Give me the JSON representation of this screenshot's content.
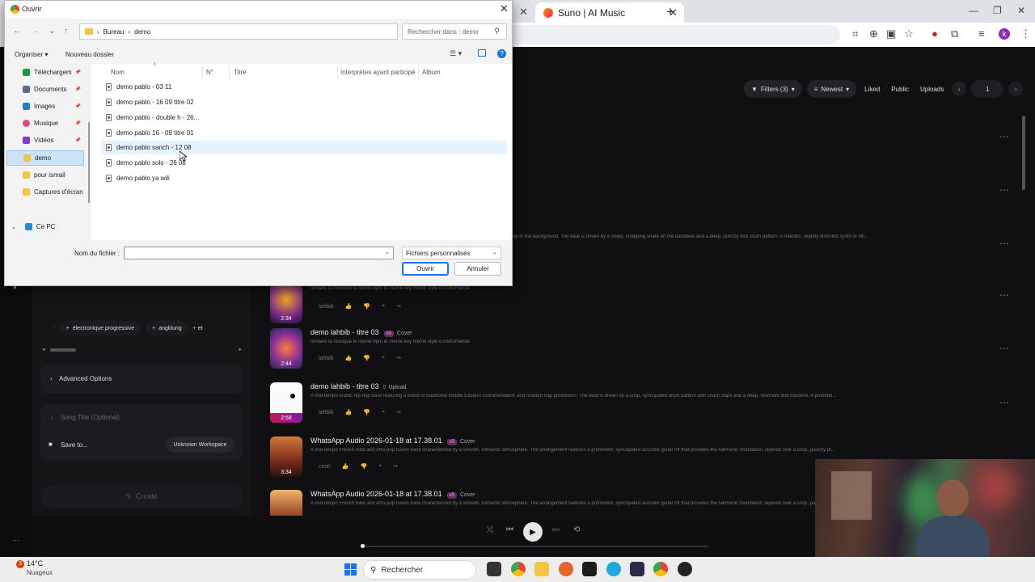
{
  "browser": {
    "active_tab": "Suno | AI Music",
    "toolbar_icons": [
      "translate-icon",
      "zoom-icon",
      "screenshot-icon",
      "bookmark-star-icon",
      "extension-icon",
      "puzzle-icon",
      "media-icon"
    ],
    "profile_initial": "k"
  },
  "dialog": {
    "title": "Ouvrir",
    "address": {
      "root": "Bureau",
      "sep": "›",
      "folder": "demo"
    },
    "search_placeholder": "Rechercher dans : demo",
    "organize": "Organiser",
    "new_folder": "Nouveau dossier",
    "nav_items": [
      {
        "label": "Téléchargem",
        "color": "#1a9c3e"
      },
      {
        "label": "Documents",
        "color": "#5b6c8f"
      },
      {
        "label": "Images",
        "color": "#1f7fd1"
      },
      {
        "label": "Musique",
        "color": "#e34d6b"
      },
      {
        "label": "Vidéos",
        "color": "#7b3fc4"
      },
      {
        "label": "demo",
        "color": "#f4c542"
      },
      {
        "label": "pour ismail",
        "color": "#f4c542"
      },
      {
        "label": "Captures d'écran",
        "color": "#f4c542"
      },
      {
        "label": "Ce PC",
        "color": "#2b8ad6"
      }
    ],
    "columns": [
      "Nom",
      "N°",
      "Titre",
      "Interprètes ayant participé",
      "Album"
    ],
    "files": [
      "demo pablo - 03 11",
      "demo pablo - 16 09 titre 02",
      "demo pablo - double h - 26...",
      "demo pablo 16 - 09 titre 01",
      "demo pablo sanch - 12 08",
      "demo pablo solo - 26 08",
      "demo pablo ya wili"
    ],
    "filename_label": "Nom du fichier :",
    "filename_value": "",
    "filetype": "Fichiers personnalisés",
    "open_btn": "Ouvrir",
    "cancel_btn": "Annuler"
  },
  "suno": {
    "filters": {
      "filters_label": "Filters (3)",
      "sort_label": "Newest",
      "liked": "Liked",
      "public": "Public",
      "uploads": "Uploads",
      "page": "1"
    },
    "left_panel": {
      "style_tags": [
        "électronique progressive",
        "angklung",
        "+ et"
      ],
      "advanced_options": "Advanced Options",
      "song_title_placeholder": "Song Title (Optional)",
      "save_to": "Save to...",
      "workspace": "Unknown Workspace",
      "create": "Create"
    },
    "partial_description": "op in the background. The beat is driven by a sharp, snapping snare on the backbeat and a deep, punchy kick drum pattern. A melodic, slightly distorted synth or stri...",
    "songs": [
      {
        "title": "",
        "version": "",
        "tag": "",
        "desc": "rentaire la musique le meme bpm et meme key meme style d instrumental",
        "duration": "2:34",
        "user": "lahbib"
      },
      {
        "title": "demo lahbib - titre 03",
        "version": "v5",
        "tag": "Cover",
        "desc": "rentaire la musique le meme bpm et meme key meme style d instrumental",
        "duration": "2:44",
        "user": "lahbib"
      },
      {
        "title": "demo lahbib - titre 03",
        "version": "",
        "tag": "Upload",
        "desc": "A mid-tempo Arabic hip-hop track featuring a blend of traditional Middle Eastern instrumentation and modern trap production. The beat is driven by a crisp, syncopated drum pattern with sharp claps and a deep, resonant 808 bassline. A promine...",
        "duration": "2:58",
        "user": "lahbib"
      },
      {
        "title": "WhatsApp Audio 2026-01-18 at 17.38.01",
        "version": "v5",
        "tag": "Cover",
        "desc": "A mid-tempo French R&B and Afro-pop fusion track characterized by a smooth, romantic atmosphere. The arrangement features a prominent, syncopated acoustic guitar riff that provides the harmonic foundation, layered over a crisp, punchy dr...",
        "duration": "3:34",
        "user": "crish"
      },
      {
        "title": "WhatsApp Audio 2026-01-18 at 17.38.01",
        "version": "v5",
        "tag": "Cover",
        "desc": "A mid-tempo French R&B and Afro-pop fusion track characterized by a smooth, romantic atmosphere. The arrangement features a prominent, syncopated acoustic guitar riff that provides the harmonic foundation, layered over a crisp, punchy dr...",
        "duration": "",
        "user": ""
      }
    ],
    "player": {
      "progress": 0.0
    }
  },
  "taskbar": {
    "temp": "14°C",
    "weather": "Nuageux",
    "weather_badge": "3",
    "search": "Rechercher"
  }
}
